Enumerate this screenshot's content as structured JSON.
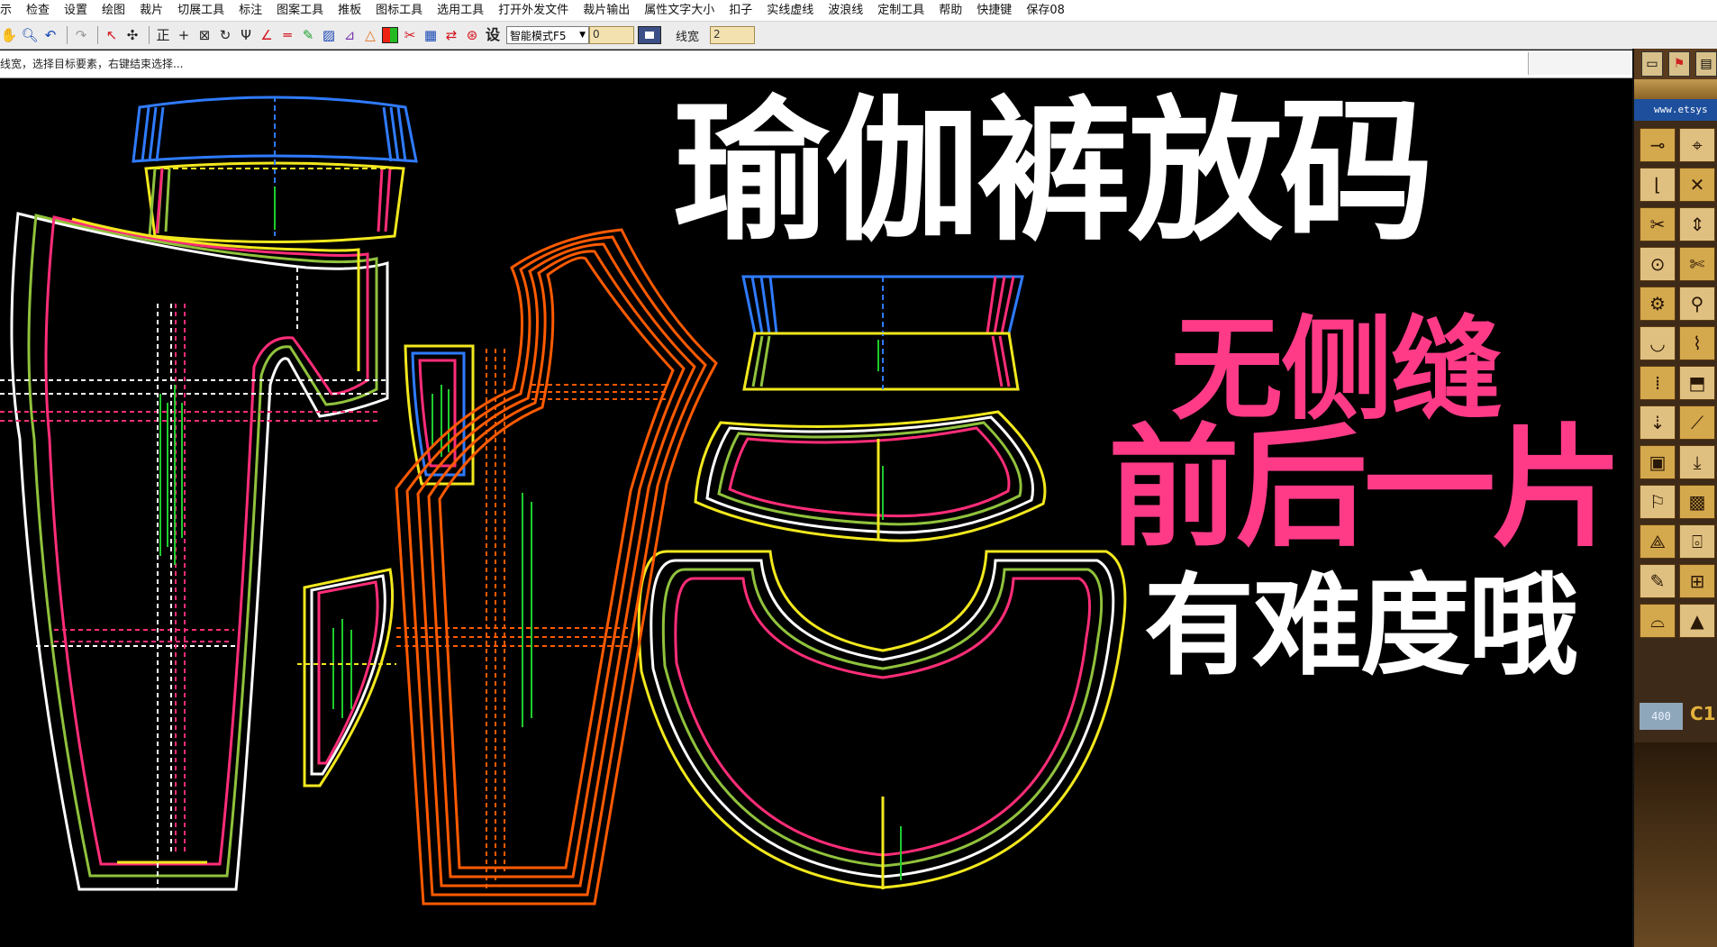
{
  "menu": [
    "示",
    "检查",
    "设置",
    "绘图",
    "裁片",
    "切展工具",
    "标注",
    "图案工具",
    "推板",
    "图标工具",
    "选用工具",
    "打开外发文件",
    "裁片输出",
    "属性文字大小",
    "扣子",
    "实线虚线",
    "波浪线",
    "定制工具",
    "帮助",
    "快捷键",
    "保存08"
  ],
  "toolbar": {
    "icons": [
      "hand-icon",
      "zoom-icon",
      "undo-icon",
      "redo-icon",
      "select-delete-icon",
      "move-points-icon",
      "straighten-icon",
      "cross-icon",
      "align-icon",
      "rotate-icon",
      "trident-icon",
      "angle-icon",
      "parallel-lines-icon",
      "pen-icon",
      "pattern-icon",
      "ruler-icon",
      "hanger-icon",
      "color-palette-icon",
      "scissors-icon",
      "grade-table-icon",
      "arrows-icon",
      "target-icon"
    ],
    "settings_label": "设",
    "mode_value": "智能模式F5",
    "number_value": "0",
    "line_width_label": "线宽",
    "line_width_value": "2"
  },
  "status": {
    "message": "线宽，选择目标要素，右键结束选择..."
  },
  "overlay": {
    "title": "瑜伽裤放码",
    "subtitle_1": "无侧缝",
    "subtitle_2": "前后一片",
    "subtitle_3": "有难度哦"
  },
  "right_panel": {
    "url": "www.etsys",
    "zoom_value": "400",
    "brand_text": "C1"
  },
  "colors": {
    "grade_sizes": [
      "#ffffff",
      "#ff2d78",
      "#90c23c",
      "#f2e81e",
      "#2f7bff",
      "#ff5a00"
    ],
    "title_pink": "#ff3b88"
  }
}
